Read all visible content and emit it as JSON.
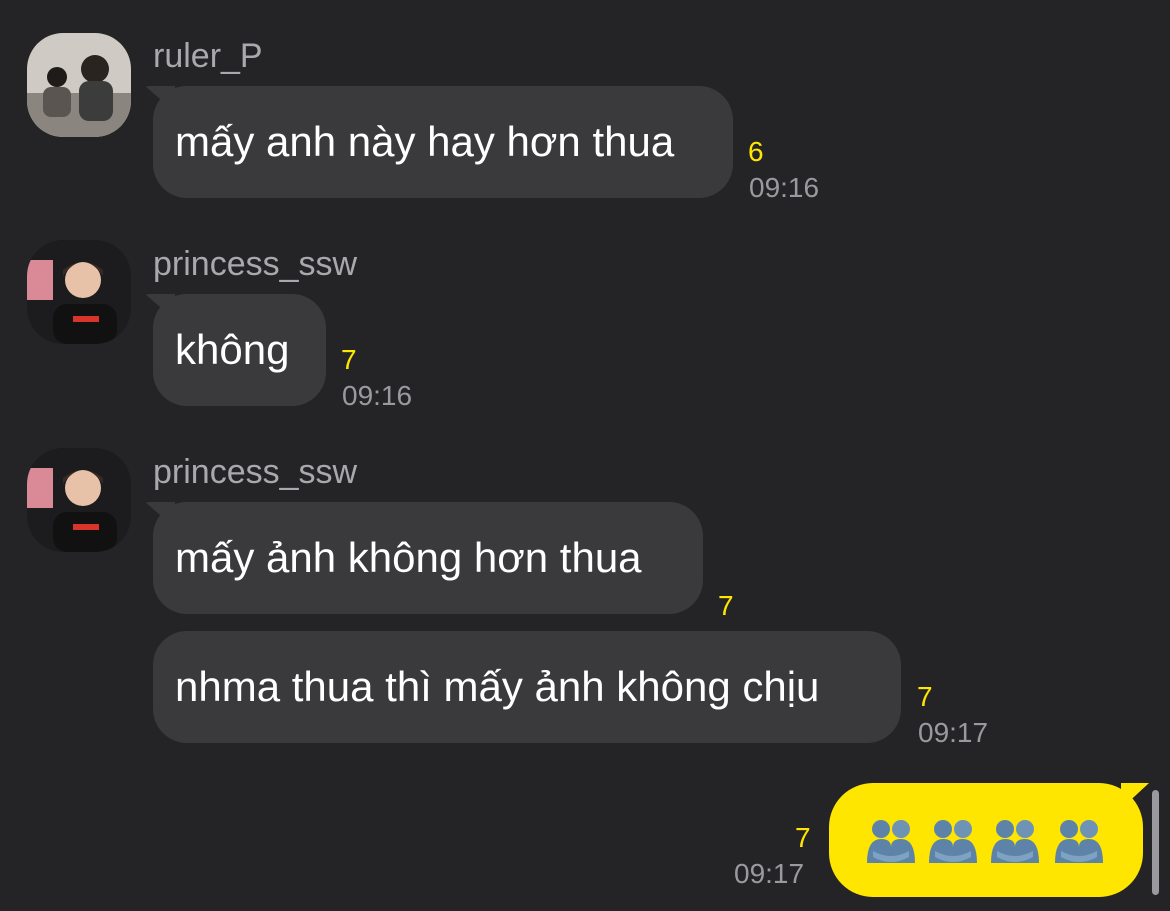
{
  "messages": [
    {
      "sender": "ruler_P",
      "text": "mấy anh này hay hơn thua",
      "unread": "6",
      "time": "09:16"
    },
    {
      "sender": "princess_ssw",
      "text": "không",
      "unread": "7",
      "time": "09:16"
    },
    {
      "sender": "princess_ssw",
      "text": "mấy ảnh không hơn thua",
      "unread": "7",
      "time": ""
    },
    {
      "sender": "",
      "text": "nhma thua thì mấy ảnh không chịu",
      "unread": "7",
      "time": "09:17"
    }
  ],
  "my_message": {
    "unread": "7",
    "time": "09:17",
    "emoji": [
      "people-hugging-icon",
      "people-hugging-icon",
      "people-hugging-icon",
      "people-hugging-icon"
    ]
  },
  "colors": {
    "background": "#242426",
    "incoming_bubble": "#3a3a3c",
    "outgoing_bubble": "#ffe600",
    "unread_count": "#ffe600"
  }
}
